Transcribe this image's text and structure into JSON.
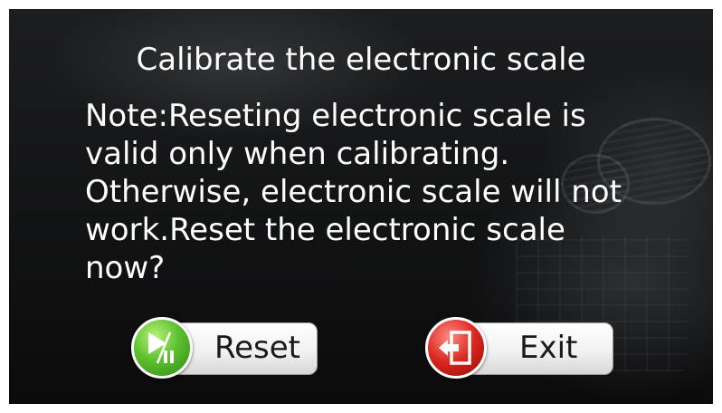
{
  "dialog": {
    "title": "Calibrate the electronic scale",
    "note_lines": [
      "Note:Reseting electronic scale is",
      "valid only when calibrating.",
      "Otherwise, electronic scale will not",
      "work.Reset the electronic scale",
      "now?"
    ]
  },
  "buttons": {
    "reset": {
      "label": "Reset",
      "icon": "play-pause-icon",
      "color": "#4cae2a"
    },
    "exit": {
      "label": "Exit",
      "icon": "exit-door-icon",
      "color": "#d02a20"
    }
  },
  "colors": {
    "text": "#ffffff",
    "background": "#141516"
  }
}
